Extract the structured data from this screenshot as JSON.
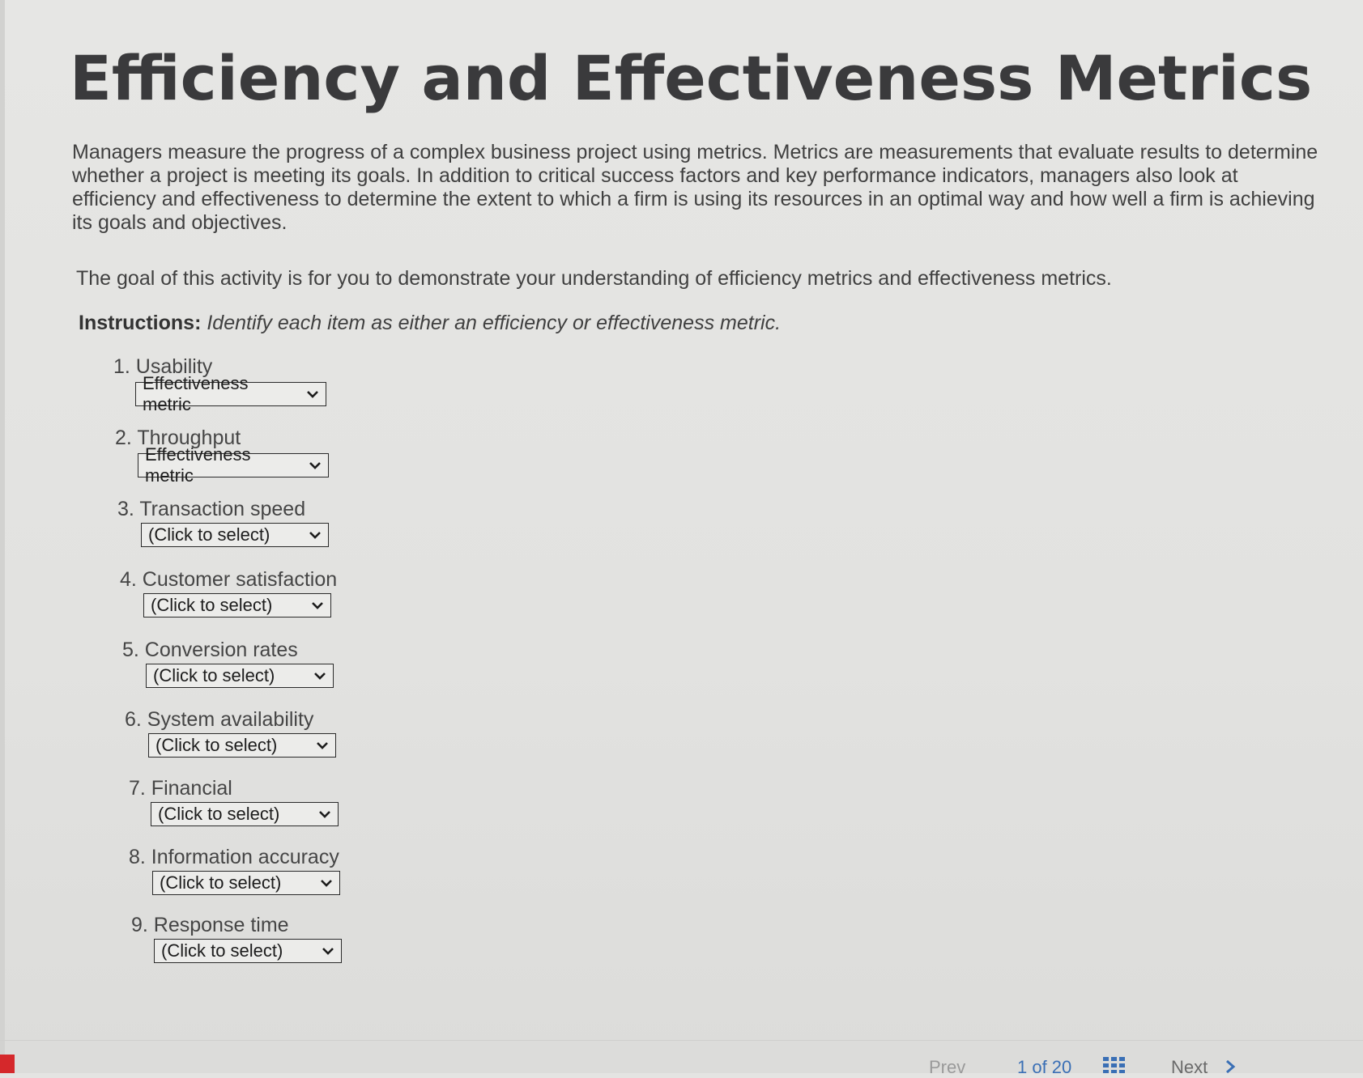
{
  "header": {
    "title": "Efficiency and Effectiveness Metrics"
  },
  "intro": {
    "paragraph": "Managers measure the progress of a complex business project using metrics. Metrics are measurements that evaluate results to determine whether a project is meeting its goals. In addition to critical success factors and key performance indicators, managers also look at efficiency and effectiveness to determine the extent to which a firm is using its resources in an optimal way and how well a firm is achieving its goals and objectives.",
    "goal": "The goal of this activity is for you to demonstrate your understanding of efficiency metrics and effectiveness metrics.",
    "instructions_label": "Instructions:",
    "instructions_text": "Identify each item as either an efficiency or effectiveness metric."
  },
  "items": [
    {
      "label": "1. Usability",
      "selected": "Effectiveness metric"
    },
    {
      "label": "2. Throughput",
      "selected": "Effectiveness metric"
    },
    {
      "label": "3. Transaction speed",
      "selected": "(Click to select)"
    },
    {
      "label": "4. Customer satisfaction",
      "selected": "(Click to select)"
    },
    {
      "label": "5. Conversion rates",
      "selected": "(Click to select)"
    },
    {
      "label": "6. System availability",
      "selected": "(Click to select)"
    },
    {
      "label": "7. Financial",
      "selected": "(Click to select)"
    },
    {
      "label": "8. Information accuracy",
      "selected": "(Click to select)"
    },
    {
      "label": "9. Response time",
      "selected": "(Click to select)"
    }
  ],
  "footer": {
    "prev_label": "Prev",
    "page_counter": "1 of 20",
    "next_label": "Next",
    "grid_icon": "grid-icon",
    "accent_color": "#3a6fb5",
    "tab_color": "#d5282b"
  }
}
